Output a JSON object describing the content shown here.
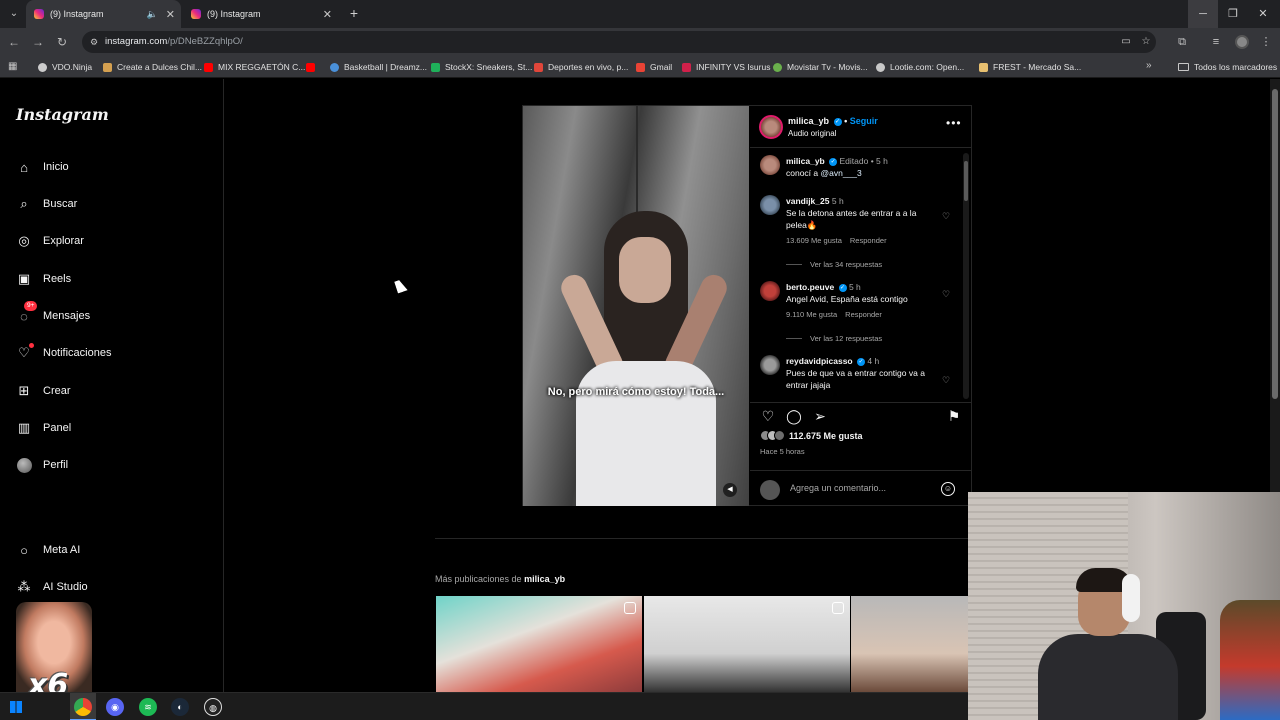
{
  "browser": {
    "tabs": [
      {
        "title": "(9) Instagram",
        "active": true,
        "audio": true
      },
      {
        "title": "(9) Instagram",
        "active": false,
        "audio": false
      }
    ],
    "url_host": "instagram.com",
    "url_path": "/p/DNeBZZqhlpO/",
    "bookmarks": [
      {
        "label": "VDO.Ninja",
        "color": "#cccccc"
      },
      {
        "label": "Create a Dulces Chil...",
        "color": "#d4a050"
      },
      {
        "label": "MIX REGGAETÓN C...",
        "color": "#ff0000"
      },
      {
        "label": "",
        "color": "#ff0000"
      },
      {
        "label": "Basketball | Dreamz...",
        "color": "#4a90d9"
      },
      {
        "label": "StockX: Sneakers, St...",
        "color": "#1fb05a"
      },
      {
        "label": "Deportes en vivo, p...",
        "color": "#e0463a"
      },
      {
        "label": "Gmail",
        "color": "#ea4335"
      },
      {
        "label": "INFINITY VS Isurus",
        "color": "#d0204a"
      },
      {
        "label": "Movistar Tv - Movis...",
        "color": "#6ab04c"
      },
      {
        "label": "Lootie.com: Open...",
        "color": "#c8c8c8"
      },
      {
        "label": "FREST - Mercado Sa...",
        "color": "#e8c070"
      }
    ],
    "all_bookmarks": "Todos los marcadores"
  },
  "sidebar": {
    "logo": "Instagram",
    "items": [
      {
        "label": "Inicio",
        "icon": "home-icon"
      },
      {
        "label": "Buscar",
        "icon": "search-icon"
      },
      {
        "label": "Explorar",
        "icon": "compass-icon"
      },
      {
        "label": "Reels",
        "icon": "reels-icon"
      },
      {
        "label": "Mensajes",
        "icon": "messenger-icon",
        "badge": "9+"
      },
      {
        "label": "Notificaciones",
        "icon": "heart-icon"
      },
      {
        "label": "Crear",
        "icon": "plus-square-icon"
      },
      {
        "label": "Panel",
        "icon": "chart-icon"
      },
      {
        "label": "Perfil",
        "icon": "avatar-icon"
      },
      {
        "label": "Meta AI",
        "icon": "meta-ai-icon"
      },
      {
        "label": "AI Studio",
        "icon": "ai-studio-icon"
      }
    ]
  },
  "post": {
    "username": "milica_yb",
    "follow": "Seguir",
    "audio": "Audio original",
    "video_caption": "No, pero mirá cómo estoy! Toda...",
    "comments": [
      {
        "user": "milica_yb",
        "verified": true,
        "time": "Editado • 5 h",
        "text_before": "conocí a ",
        "mention": "@avn___3",
        "text_after": "",
        "likes": "",
        "reply": "",
        "view_replies": ""
      },
      {
        "user": "vandijk_25",
        "verified": false,
        "time": "5 h",
        "text_before": "Se la detona antes de entrar a a la pelea🔥",
        "mention": "",
        "text_after": "",
        "likes": "13.609 Me gusta",
        "reply": "Responder",
        "view_replies": "Ver las 34 respuestas"
      },
      {
        "user": "berto.peuve",
        "verified": true,
        "time": "5 h",
        "text_before": "Angel Avid, España está contigo",
        "mention": "",
        "text_after": "",
        "likes": "9.110 Me gusta",
        "reply": "Responder",
        "view_replies": "Ver las 12 respuestas"
      },
      {
        "user": "reydavidpicasso",
        "verified": true,
        "time": "4 h",
        "text_before": "Pues de que va a entrar contigo va a entrar jajaja",
        "mention": "",
        "text_after": "",
        "likes": "",
        "reply": "",
        "view_replies": ""
      }
    ],
    "likes": "112.675 Me gusta",
    "posted_ago": "Hace 5 horas",
    "comment_placeholder": "Agrega un comentario..."
  },
  "more_posts": {
    "prefix": "Más publicaciones de ",
    "user": "milica_yb"
  },
  "overlay": {
    "multiplier": "x6"
  }
}
